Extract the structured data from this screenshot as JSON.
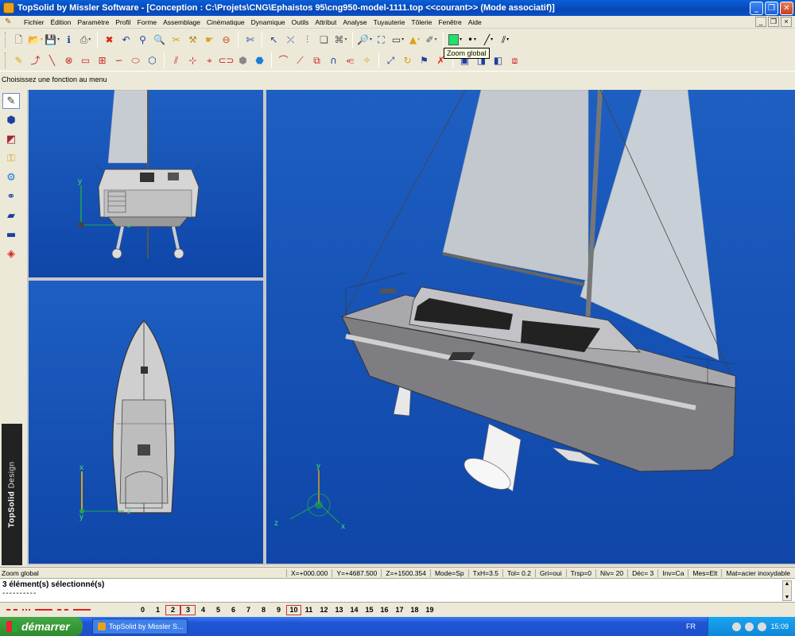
{
  "window": {
    "title": "TopSolid by Missler Software - [Conception : C:\\Projets\\CNG\\Ephaistos 95\\cng950-model-1111.top  <<courant>> (Mode associatif)]"
  },
  "menu": {
    "items": [
      "Fichier",
      "Édition",
      "Paramètre",
      "Profil",
      "Forme",
      "Assemblage",
      "Cinématique",
      "Dynamique",
      "Outils",
      "Attribut",
      "Analyse",
      "Tuyauterie",
      "Tôlerie",
      "Fenêtre",
      "Aide"
    ]
  },
  "tooltip": "Zoom global",
  "prompt": "Choisissez une fonction au menu",
  "brand": {
    "name": "TopSolid",
    "suffix": "Design"
  },
  "axes": {
    "y": "y",
    "x": "x",
    "z": "z"
  },
  "status": {
    "hint": "Zoom global",
    "fields": [
      "X=+000.000",
      "Y=+4687.500",
      "Z=+1500.354",
      "Mode=Sp",
      "TxH=3.5",
      "Tol=  0.2",
      "Gri=oui",
      "Trsp=0",
      "Niv= 20",
      "Déc= 3",
      "Inv=Ca",
      "Mes=Elt",
      "Mat=acier inoxydable"
    ]
  },
  "messages": {
    "title": "3 élément(s) sélectionné(s)",
    "dashes": "----------"
  },
  "layers": [
    "0",
    "1",
    "2",
    "3",
    "4",
    "5",
    "6",
    "7",
    "8",
    "9",
    "10",
    "11",
    "12",
    "13",
    "14",
    "15",
    "16",
    "17",
    "18",
    "19"
  ],
  "layers_boxed": [
    "2",
    "3",
    "10"
  ],
  "taskbar": {
    "start": "démarrer",
    "task": "TopSolid by Missler S...",
    "lang": "FR",
    "time": "15:09"
  },
  "colors": {
    "current_color": "#1ee36a",
    "viewport_bg": "#1e5fc2",
    "hull": "#7d7d82",
    "sail": "#c7ccd3"
  }
}
